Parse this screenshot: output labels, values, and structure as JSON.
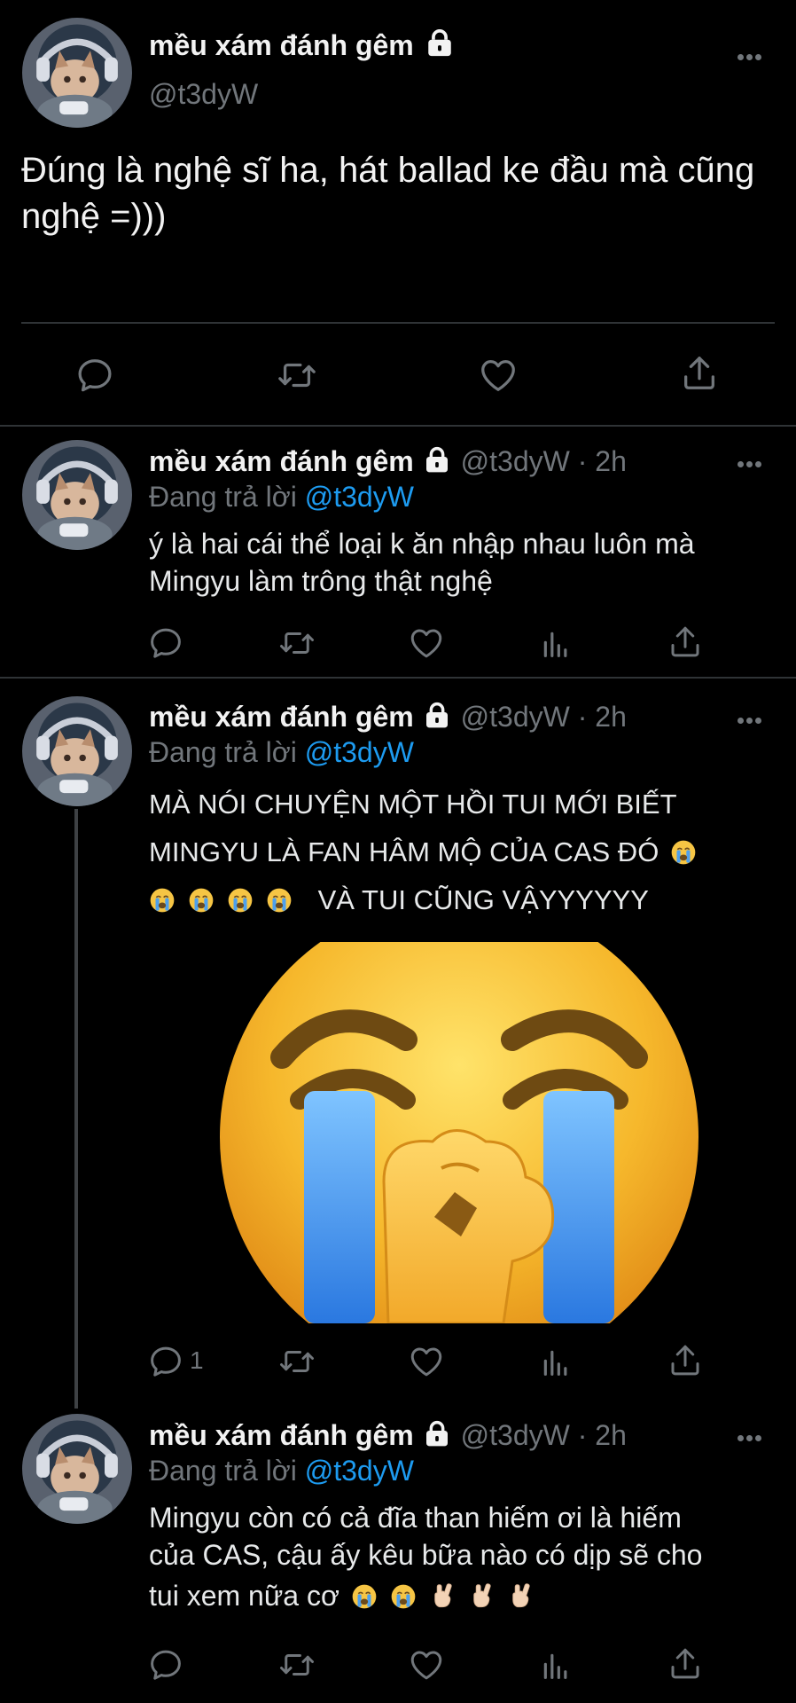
{
  "main_tweet": {
    "author_name": "mều xám đánh gêm",
    "handle": "@t3dyW",
    "text": "Đúng là nghệ sĩ ha, hát ballad ke đầu mà cũng nghệ =)))"
  },
  "replies": [
    {
      "author_name": "mều xám đánh gêm",
      "handle_time": "@t3dyW · 2h",
      "replying_prefix": "Đang trả lời",
      "replying_to": "@t3dyW",
      "text_line1": "ý là hai cái thể loại k ăn nhập nhau luôn mà",
      "text_line2": "Mingyu làm trông thật nghệ"
    },
    {
      "author_name": "mều xám đánh gêm",
      "handle_time": "@t3dyW · 2h",
      "replying_prefix": "Đang trả lời",
      "replying_to": "@t3dyW",
      "text_line1": "MÀ NÓI CHUYỆN MỘT HỒI TUI MỚI BIẾT",
      "text_line2": "MINGYU LÀ FAN HÂM MỘ CỦA CAS ĐÓ",
      "text_line3": "VÀ TUI CŨNG VẬYYYYYY",
      "reply_count": "1",
      "media": "loudly-crying-face-emoji"
    },
    {
      "author_name": "mều xám đánh gêm",
      "handle_time": "@t3dyW · 2h",
      "replying_prefix": "Đang trả lời",
      "replying_to": "@t3dyW",
      "text_line1": "Mingyu còn có cả đĩa than hiếm ơi là hiếm",
      "text_line2": "của CAS, cậu ấy kêu bữa nào có dịp sẽ cho",
      "text_line3": "tui xem nữa cơ"
    }
  ],
  "icons": {
    "reply": "speech-bubble-icon",
    "retweet": "retweet-icon",
    "like": "heart-icon",
    "analytics": "bar-chart-icon",
    "share": "share-icon",
    "lock": "lock-icon",
    "more": "more-icon"
  },
  "colors": {
    "background": "#000000",
    "text": "#e7e9ea",
    "secondary": "#71767b",
    "link": "#1d9bf0",
    "divider": "#2f3336"
  }
}
